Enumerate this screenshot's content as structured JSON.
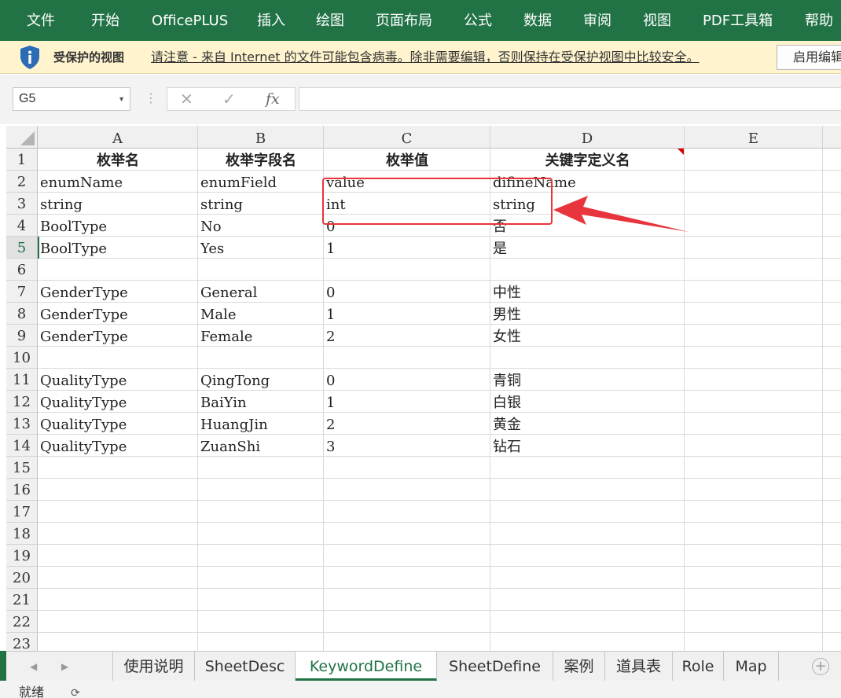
{
  "ribbon": {
    "tabs": [
      "文件",
      "开始",
      "OfficePLUS",
      "插入",
      "绘图",
      "页面布局",
      "公式",
      "数据",
      "审阅",
      "视图",
      "PDF工具箱",
      "帮助"
    ]
  },
  "protected_view": {
    "title": "受保护的视图",
    "message": "请注意 - 来自 Internet 的文件可能包含病毒。除非需要编辑，否则保持在受保护视图中比较安全。",
    "enable_button": "启用编辑"
  },
  "formula_bar": {
    "name_box": "G5",
    "cancel_icon": "✕",
    "enter_icon": "✓",
    "fx_label": "fx",
    "value": ""
  },
  "columns": [
    "A",
    "B",
    "C",
    "D",
    "E"
  ],
  "row_numbers": [
    "1",
    "2",
    "3",
    "4",
    "5",
    "6",
    "7",
    "8",
    "9",
    "10",
    "11",
    "12",
    "13",
    "14",
    "15",
    "16",
    "17",
    "18",
    "19",
    "20",
    "21",
    "22",
    "23"
  ],
  "selected_row": "5",
  "sheet": {
    "header": [
      "枚举名",
      "枚举字段名",
      "枚举值",
      "关键字定义名"
    ],
    "rows": [
      [
        "enumName",
        "enumField",
        "value",
        "difineName"
      ],
      [
        "string",
        "string",
        "int",
        "string"
      ],
      [
        "BoolType",
        "No",
        "0",
        "否"
      ],
      [
        "BoolType",
        "Yes",
        "1",
        "是"
      ],
      [
        "",
        "",
        "",
        ""
      ],
      [
        "GenderType",
        "General",
        "0",
        "中性"
      ],
      [
        "GenderType",
        "Male",
        "1",
        "男性"
      ],
      [
        "GenderType",
        "Female",
        "2",
        "女性"
      ],
      [
        "",
        "",
        "",
        ""
      ],
      [
        "QualityType",
        "QingTong",
        "0",
        "青铜"
      ],
      [
        "QualityType",
        "BaiYin",
        "1",
        "白银"
      ],
      [
        "QualityType",
        "HuangJin",
        "2",
        "黄金"
      ],
      [
        "QualityType",
        "ZuanShi",
        "3",
        "钻石"
      ]
    ]
  },
  "sheet_tabs": [
    "使用说明",
    "SheetDesc",
    "KeywordDefine",
    "SheetDefine",
    "案例",
    "道具表",
    "Role",
    "Map"
  ],
  "active_sheet": "KeywordDefine",
  "status_bar": {
    "ready": "就绪"
  },
  "colors": {
    "accent": "#217346",
    "annotation_red": "#e8343c",
    "protected_bar": "#fff4ce"
  }
}
